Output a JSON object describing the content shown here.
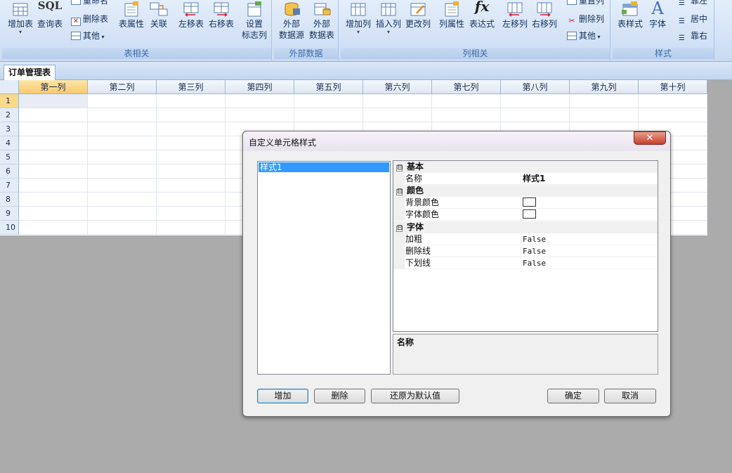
{
  "ribbon": {
    "groups": [
      {
        "title": "表相关"
      },
      {
        "title": "外部数据"
      },
      {
        "title": "列相关"
      },
      {
        "title": "样式"
      }
    ],
    "table_buttons": {
      "add_table": "增加表",
      "query_table": "查询表",
      "rename": "重命名",
      "delete_table": "删除表",
      "other": "其他",
      "table_props": "表属性",
      "relation": "关联",
      "move_left": "左移表",
      "move_right": "右移表",
      "set_flag_l1": "设置",
      "set_flag_l2": "标志列"
    },
    "external_buttons": {
      "ext_src_l1": "外部",
      "ext_src_l2": "数据源",
      "ext_db_l1": "外部",
      "ext_db_l2": "数据表"
    },
    "column_buttons": {
      "add_col": "增加列",
      "insert_col": "插入列",
      "change_col": "更改列",
      "col_props": "列属性",
      "expression": "表达式",
      "col_left": "左移列",
      "col_right": "右移列",
      "reset_col": "重置列",
      "delete_col": "删除列",
      "other": "其他"
    },
    "style_buttons": {
      "table_style": "表样式",
      "font": "字体",
      "align_left": "靠左",
      "align_center": "居中",
      "align_right": "靠右"
    },
    "sql_label": "SQL",
    "fx_label": "fx",
    "font_glyph": "A"
  },
  "sheet_tab": "订单管理表",
  "grid": {
    "columns": [
      "第一列",
      "第二列",
      "第三列",
      "第四列",
      "第五列",
      "第六列",
      "第七列",
      "第八列",
      "第九列",
      "第十列"
    ],
    "rows": [
      "1",
      "2",
      "3",
      "4",
      "5",
      "6",
      "7",
      "8",
      "9",
      "10"
    ]
  },
  "dialog": {
    "title": "自定义单元格样式",
    "close": "✕",
    "styles": [
      "样式1"
    ],
    "categories": {
      "basic": "基本",
      "color": "颜色",
      "font": "字体"
    },
    "toggle": "⊟",
    "props": {
      "name_label": "名称",
      "name_value": "样式1",
      "bg_label": "背景颜色",
      "fg_label": "字体颜色",
      "bold_label": "加粗",
      "bold_value": "False",
      "strike_label": "删除线",
      "strike_value": "False",
      "underline_label": "下划线",
      "underline_value": "False"
    },
    "description_title": "名称",
    "buttons": {
      "add": "增加",
      "delete": "删除",
      "reset": "还原为默认值",
      "ok": "确定",
      "cancel": "取消"
    }
  },
  "colors": {
    "accent": "#3399ff",
    "ribbon": "#c9dbf2",
    "close": "#c5402a"
  }
}
